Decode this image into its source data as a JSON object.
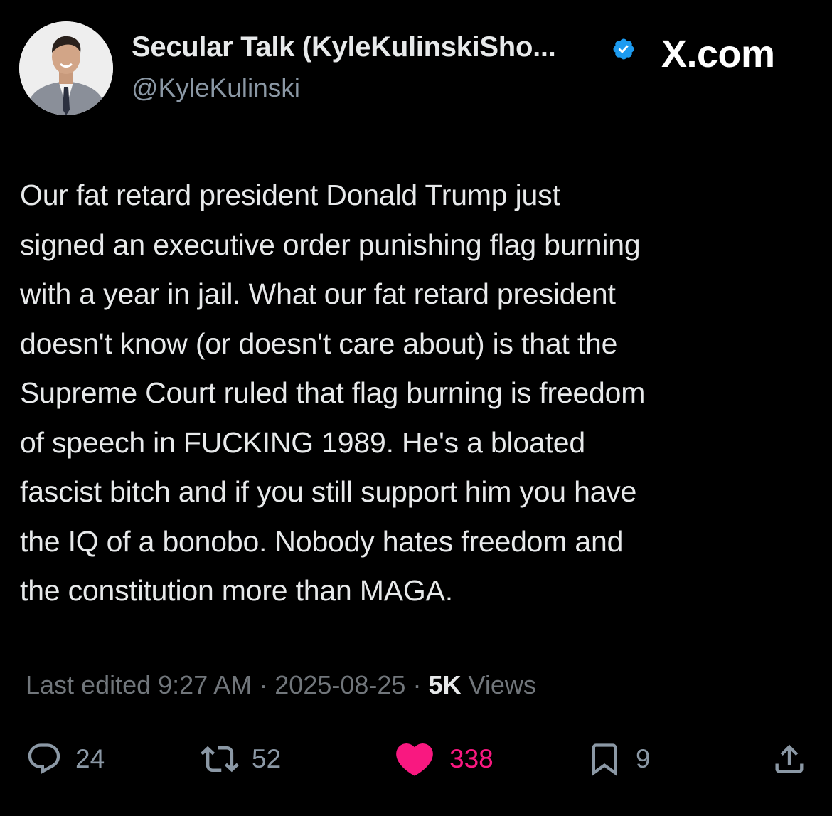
{
  "header": {
    "author_name": "Secular Talk (KyleKulinskiSho...",
    "author_handle": "@KyleKulinski",
    "site_label": "X.com",
    "verified": true,
    "verified_color": "#1d9bf0"
  },
  "tweet": {
    "text": "Our fat retard president Donald Trump just\nsigned an executive order punishing flag burning\nwith a year in jail. What our fat retard president\ndoesn't know (or doesn't care about) is that the\nSupreme Court ruled that flag burning is freedom\nof speech in FUCKING 1989. He's a bloated\nfascist bitch and if you still support him you have\nthe IQ of a bonobo. Nobody hates freedom and\nthe constitution more than MAGA."
  },
  "meta": {
    "edited_label": "Last edited",
    "time": "9:27 AM",
    "separator": "·",
    "date": "2025-08-25",
    "views_count": "5K",
    "views_label": "Views"
  },
  "actions": {
    "replies": {
      "icon": "reply-icon",
      "count": "24"
    },
    "reposts": {
      "icon": "repost-icon",
      "count": "52"
    },
    "likes": {
      "icon": "heart-icon",
      "count": "338",
      "active": true,
      "color": "#f91880"
    },
    "bookmarks": {
      "icon": "bookmark-icon",
      "count": "9"
    },
    "share": {
      "icon": "share-icon"
    }
  }
}
